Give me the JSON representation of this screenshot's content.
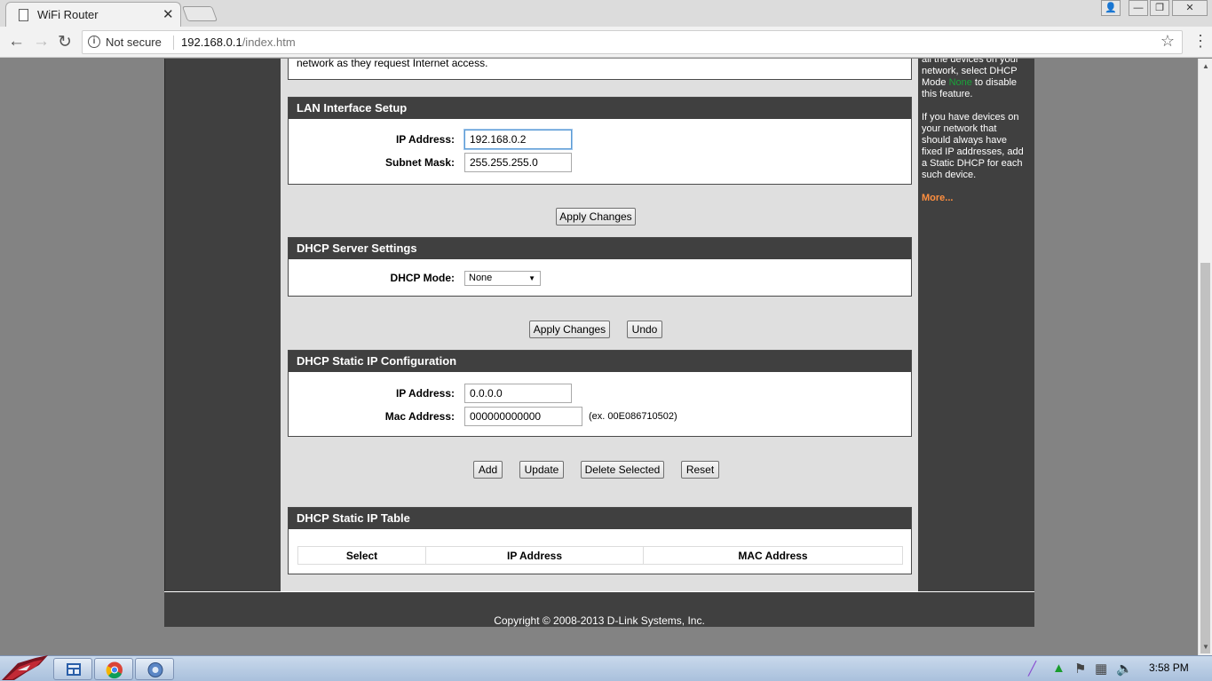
{
  "browser": {
    "tab_title": "WiFi Router",
    "tab_close": "✕",
    "security_label": "Not secure",
    "url_host": "192.168.0.1",
    "url_path": "/index.htm",
    "nav_back": "←",
    "nav_forward": "→",
    "nav_reload": "↻",
    "star": "☆",
    "menu": "⋮",
    "win_user": "👤",
    "win_min": "—",
    "win_restore": "❐",
    "win_close": "✕"
  },
  "top_text": "network as they request Internet access.",
  "lan": {
    "title": "LAN Interface Setup",
    "ip_label": "IP Address:",
    "ip_value": "192.168.0.2",
    "mask_label": "Subnet Mask:",
    "mask_value": "255.255.255.0",
    "apply_label": "Apply Changes"
  },
  "dhcp": {
    "title": "DHCP Server Settings",
    "mode_label": "DHCP Mode:",
    "mode_value": "None",
    "apply_label": "Apply Changes",
    "undo_label": "Undo"
  },
  "static": {
    "title": "DHCP Static IP Configuration",
    "ip_label": "IP Address:",
    "ip_value": "0.0.0.0",
    "mac_label": "Mac Address:",
    "mac_value": "000000000000",
    "mac_hint": "(ex. 00E086710502)",
    "add_label": "Add",
    "update_label": "Update",
    "delete_label": "Delete Selected",
    "reset_label": "Reset"
  },
  "table": {
    "title": "DHCP Static IP Table",
    "columns": [
      "Select",
      "IP Address",
      "MAC Address"
    ]
  },
  "help": {
    "p1_a": "all the devices on your network, select DHCP Mode ",
    "p1_none": "None",
    "p1_b": " to disable this feature.",
    "p2": "If you have devices on your network that should always have fixed IP addresses, add a Static DHCP for each such device.",
    "more": "More..."
  },
  "footer": "Copyright © 2008-2013 D-Link Systems, Inc.",
  "taskbar": {
    "clock": "3:58 PM"
  }
}
